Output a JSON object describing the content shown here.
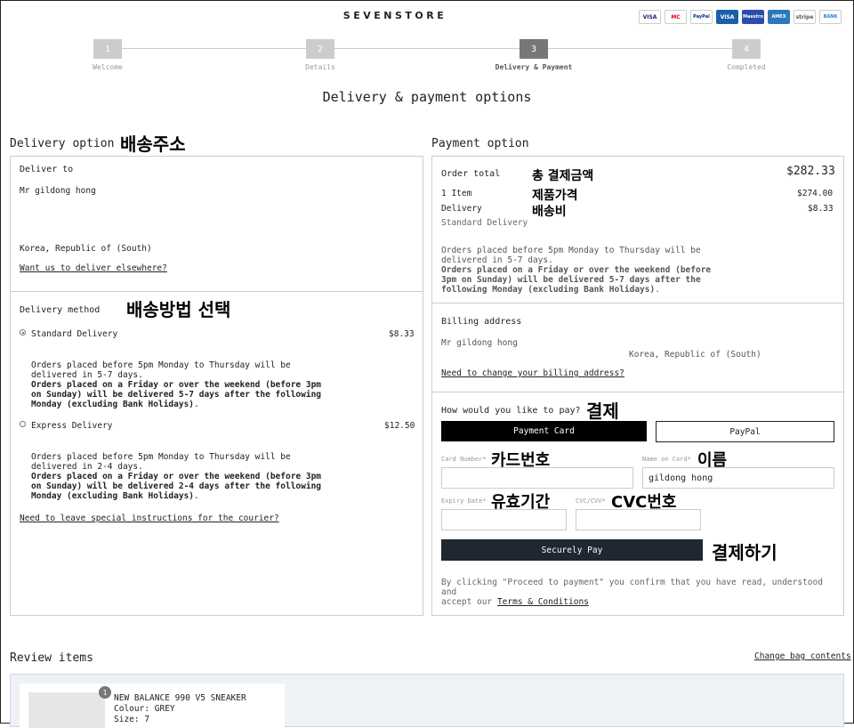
{
  "header": {
    "brand": "SEVENSTORE",
    "payment_logos": [
      "VISA",
      "MC",
      "PayPal",
      "VISA",
      "Maestro",
      "AMEX",
      "stripe",
      "BANK"
    ]
  },
  "steps": [
    {
      "num": "1",
      "label": "Welcome"
    },
    {
      "num": "2",
      "label": "Details"
    },
    {
      "num": "3",
      "label": "Delivery & Payment"
    },
    {
      "num": "4",
      "label": "Completed"
    }
  ],
  "page_title": "Delivery & payment options",
  "delivery": {
    "title": "Delivery option",
    "note": "배송주소",
    "deliver_to_label": "Deliver to",
    "name": "Mr gildong hong",
    "country": "Korea, Republic of (South)",
    "elsewhere_link": "Want us to deliver elsewhere?",
    "method_label": "Delivery method",
    "method_note": "배송방법 선택",
    "standard": {
      "label": "Standard Delivery",
      "price": "$8.33",
      "desc1": "Orders placed before 5pm Monday to Thursday will be",
      "desc2": "delivered in 5-7 days.",
      "bold1": "Orders placed on a Friday or over the weekend (before 3pm",
      "bold2": "on Sunday) will be delivered 5-7 days after the following",
      "bold3": "Monday (excluding Bank Holidays)",
      "period": "."
    },
    "express": {
      "label": "Express Delivery",
      "price": "$12.50",
      "desc1": "Orders placed before 5pm Monday to Thursday will be",
      "desc2": "delivered in 2-4 days.",
      "bold1": "Orders placed on a Friday or over the weekend (before 3pm",
      "bold2": "on Sunday) will be delivered 2-4 days after the following",
      "bold3": "Monday (excluding Bank Holidays)",
      "period": "."
    },
    "courier_link": "Need to leave special instructions for the courier?"
  },
  "payment": {
    "title": "Payment option",
    "order_total_label": "Order total",
    "order_total_note": "총 결제금액",
    "order_total": "$282.33",
    "items_label": "1 Item",
    "items_note": "제품가격",
    "items_price": "$274.00",
    "delivery_label": "Delivery",
    "delivery_note": "배송비",
    "delivery_price": "$8.33",
    "delivery_type": "Standard Delivery",
    "desc1": "Orders placed before 5pm Monday to Thursday will be",
    "desc2": "delivered in 5-7 days.",
    "bold1": "Orders placed on a Friday or over the weekend (before",
    "bold2": "3pm on Sunday) will be delivered 5-7 days after the",
    "bold3": "following Monday (excluding Bank Holidays)",
    "period": ".",
    "billing_label": "Billing address",
    "billing_name": "Mr gildong hong",
    "billing_country": "Korea, Republic of (South)",
    "billing_link": "Need to change your billing address?",
    "how_pay": "How would you like to pay?",
    "how_pay_note": "결제",
    "tab_card": "Payment Card",
    "tab_paypal": "PayPal",
    "card_number_label": "Card Number*",
    "card_number_note": "카드번호",
    "name_on_card_label": "Name on Card*",
    "name_on_card_note": "이름",
    "name_on_card_value": "gildong hong",
    "expiry_label": "Expiry Date*",
    "expiry_note": "유효기간",
    "cvc_label": "CVC/CVV*",
    "cvc_note": "CVC번호",
    "secure_pay": "Securely Pay",
    "secure_pay_note": "결제하기",
    "terms_prefix1": "By clicking \"Proceed to payment\" you confirm that you have read, understood and",
    "terms_prefix2": "accept our",
    "terms_link": "Terms & Conditions"
  },
  "review": {
    "title": "Review items",
    "change_link": "Change bag contents",
    "item_qty": "1",
    "item_name": "NEW BALANCE 990 V5 SNEAKER",
    "item_colour": "Colour: GREY",
    "item_size": "Size: 7"
  }
}
